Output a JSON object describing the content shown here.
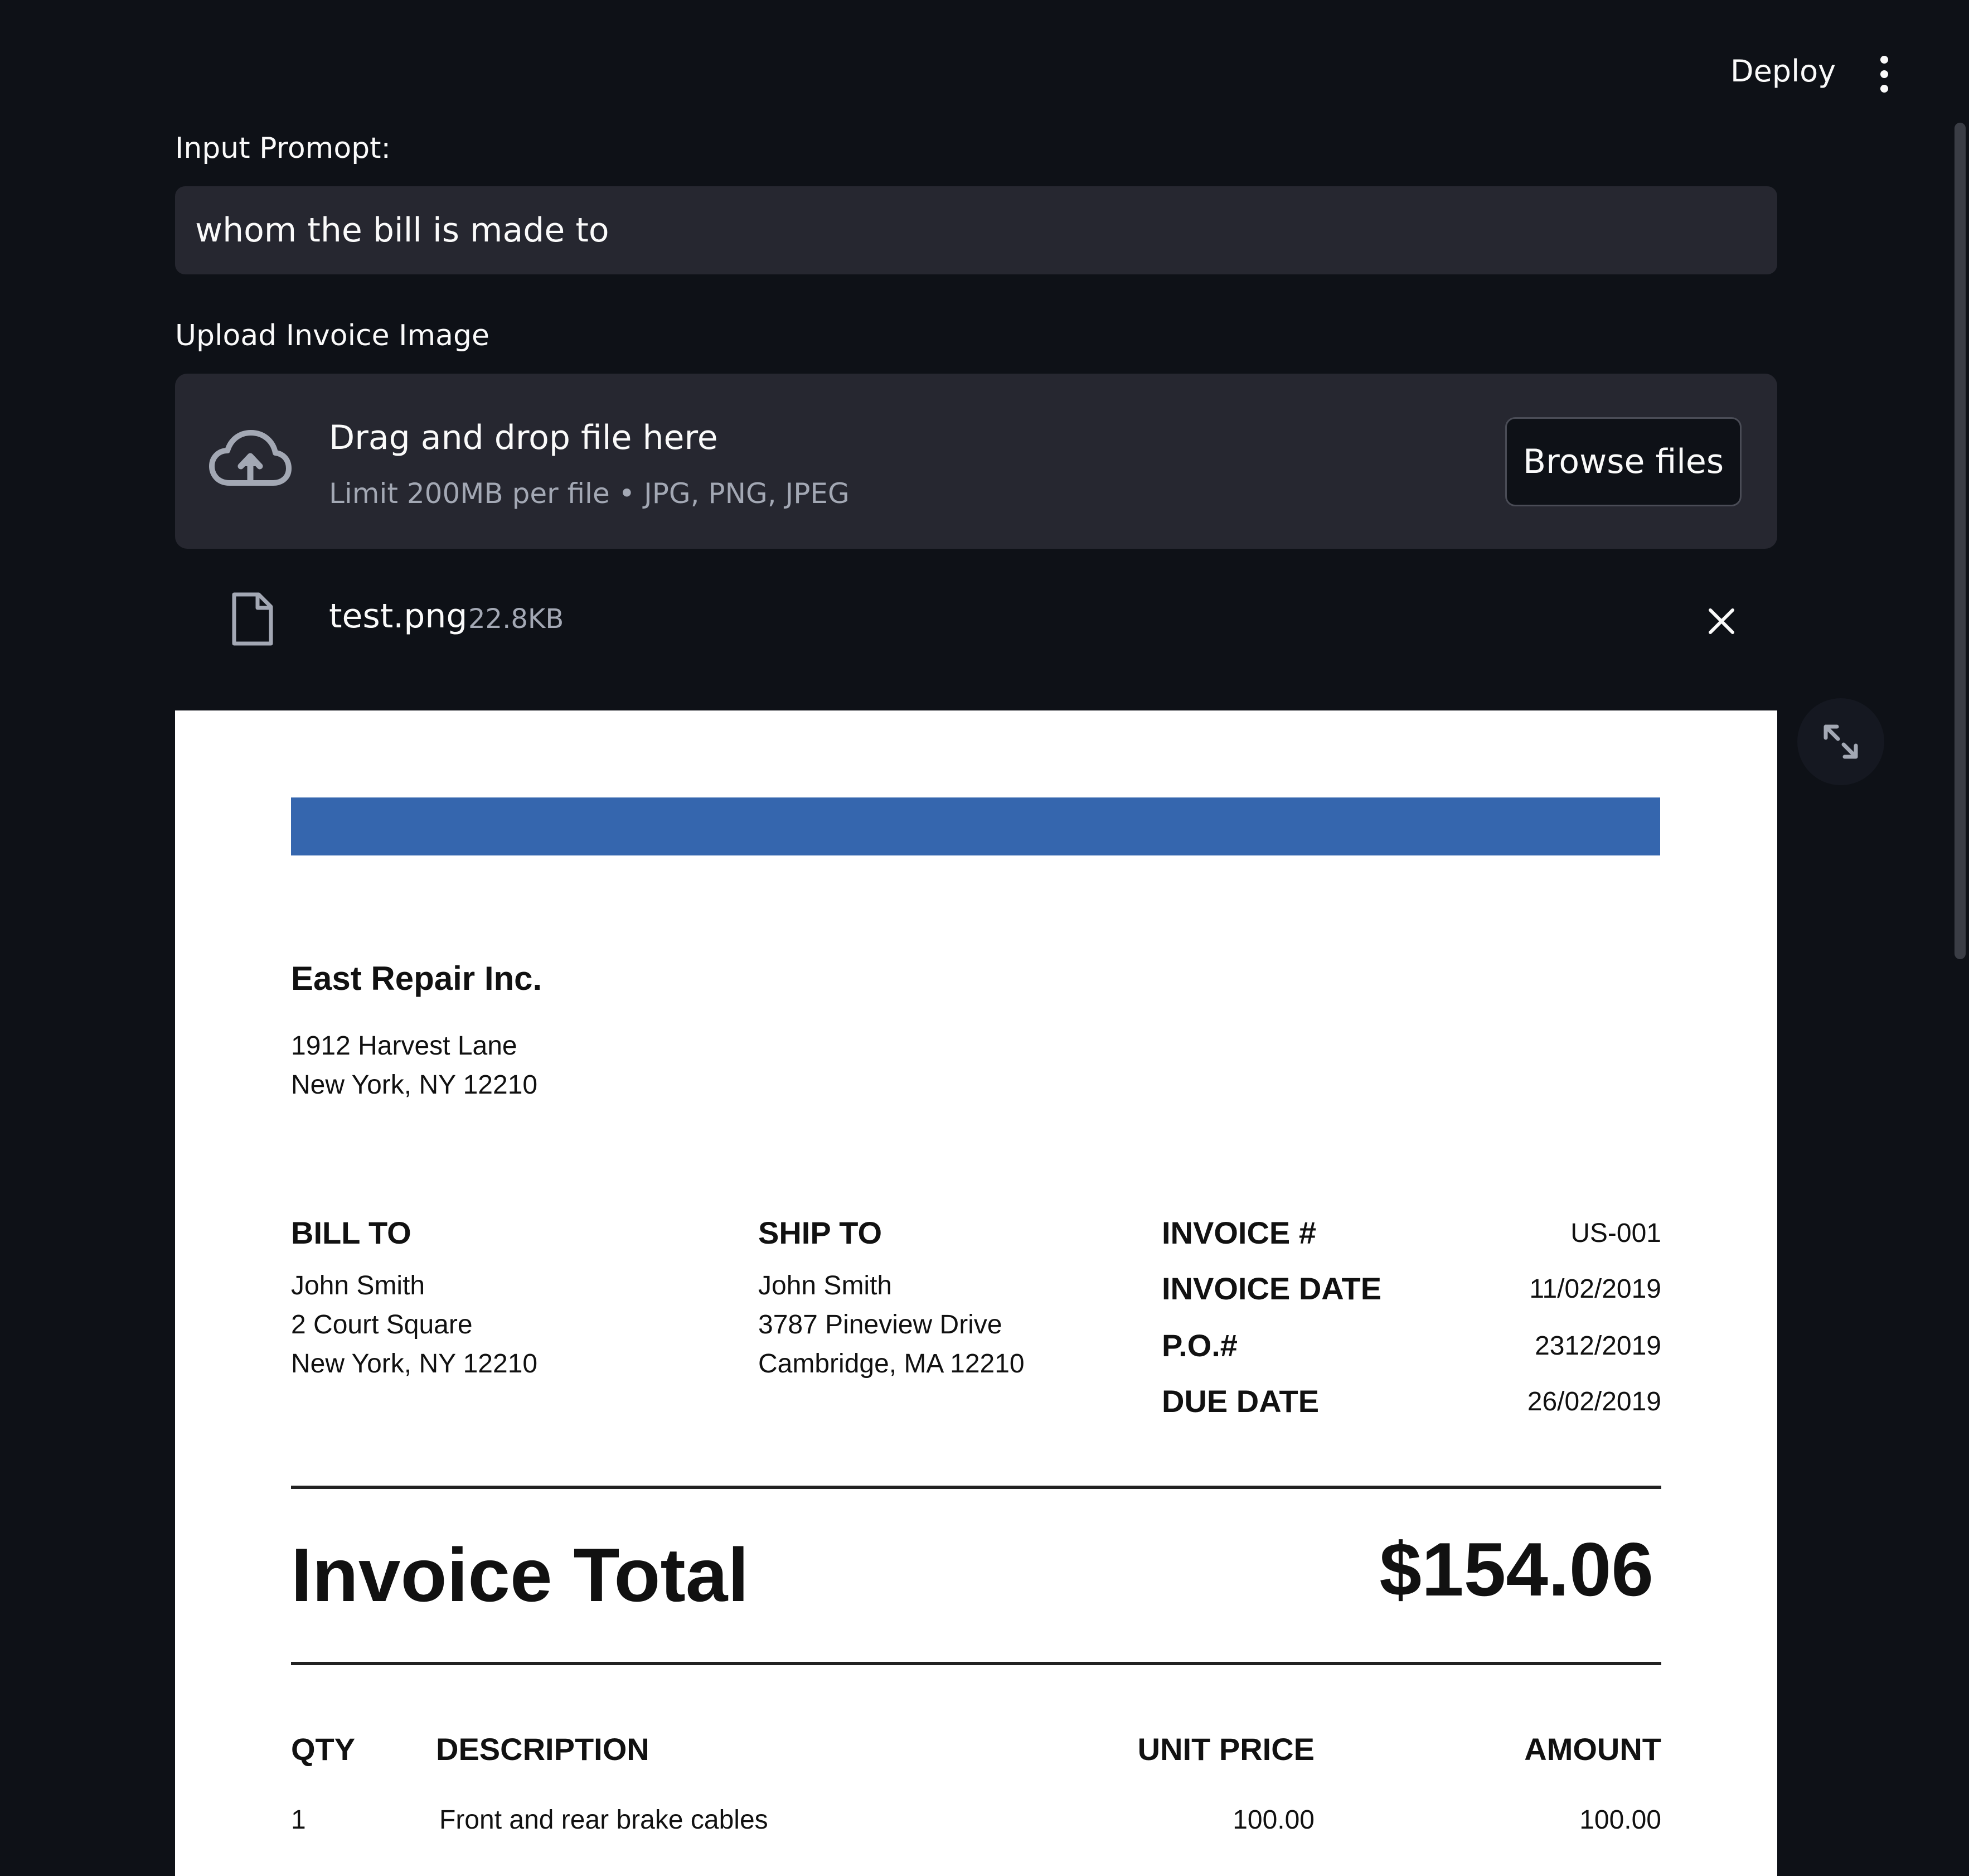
{
  "header": {
    "deploy_label": "Deploy",
    "menu_icon": "kebab-menu-icon"
  },
  "prompt": {
    "label": "Input Promopt:",
    "value": "whom the bill is made to"
  },
  "uploader": {
    "label": "Upload Invoice Image",
    "icon": "cloud-upload-icon",
    "title": "Drag and drop file here",
    "subtitle": "Limit 200MB per file • JPG, PNG, JPEG",
    "browse_label": "Browse files"
  },
  "file": {
    "icon": "file-icon",
    "name": "test.png",
    "size": "22.8KB",
    "remove_icon": "close-icon"
  },
  "image_view": {
    "expand_icon": "fullscreen-icon"
  },
  "invoice": {
    "company": "East Repair Inc.",
    "company_address_1": "1912 Harvest Lane",
    "company_address_2": "New York, NY 12210",
    "bill_to": {
      "heading": "BILL TO",
      "name": "John Smith",
      "line1": "2 Court Square",
      "line2": "New York, NY 12210"
    },
    "ship_to": {
      "heading": "SHIP TO",
      "name": "John Smith",
      "line1": "3787 Pineview Drive",
      "line2": "Cambridge, MA 12210"
    },
    "meta": [
      {
        "label": "INVOICE #",
        "value": "US-001"
      },
      {
        "label": "INVOICE DATE",
        "value": "11/02/2019"
      },
      {
        "label": "P.O.#",
        "value": "2312/2019"
      },
      {
        "label": "DUE DATE",
        "value": "26/02/2019"
      }
    ],
    "total_label": "Invoice Total",
    "total_value": "$154.06",
    "columns": [
      "QTY",
      "DESCRIPTION",
      "UNIT PRICE",
      "AMOUNT"
    ],
    "rows": [
      {
        "qty": "1",
        "description": "Front and rear brake cables",
        "unit_price": "100.00",
        "amount": "100.00"
      }
    ]
  },
  "colors": {
    "background": "#0e1117",
    "surface": "#262730",
    "invoice_accent": "#3566ae"
  }
}
